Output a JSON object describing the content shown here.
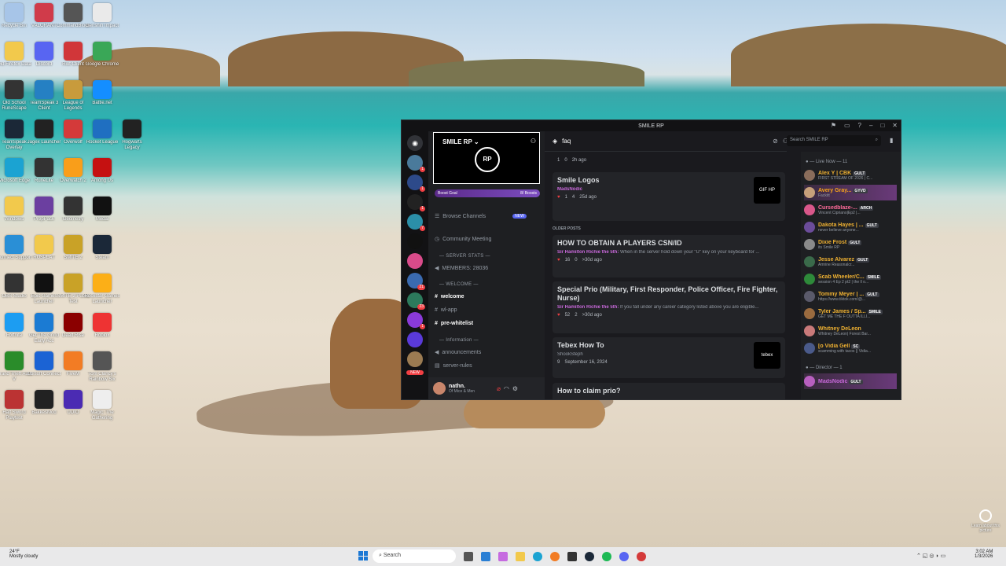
{
  "desktop_icons": [
    {
      "label": "Recycle Bin",
      "color": "#a7c5e8"
    },
    {
      "label": "VALORANT",
      "color": "#d03b4a"
    },
    {
      "label": "CommandBlock",
      "color": "#555"
    },
    {
      "label": "Genshin Impact",
      "color": "#eaeaea"
    },
    {
      "label": "Old Firefox Data",
      "color": "#f2c94c"
    },
    {
      "label": "Discord",
      "color": "#5865f2"
    },
    {
      "label": "Riot Client",
      "color": "#d13639"
    },
    {
      "label": "Google Chrome",
      "color": "#3aa757"
    },
    {
      "label": "Old School RuneScape",
      "color": "#333"
    },
    {
      "label": "TeamSpeak 3 Client",
      "color": "#2580c3"
    },
    {
      "label": "League of Legends",
      "color": "#c89b3c"
    },
    {
      "label": "Battle.net",
      "color": "#148eff"
    },
    {
      "label": "TeamSpeak Overlay",
      "color": "#1b2837"
    },
    {
      "label": "Jagex Launcher",
      "color": "#222"
    },
    {
      "label": "Overwolf",
      "color": "#d43a3a"
    },
    {
      "label": "Rocket League",
      "color": "#1f6fc1"
    },
    {
      "label": "Hogwarts Legacy",
      "color": "#222"
    },
    {
      "label": "Microsoft Edge",
      "color": "#1ba3d2"
    },
    {
      "label": "RuneLite",
      "color": "#333"
    },
    {
      "label": "Overwatch 2",
      "color": "#f99e1a"
    },
    {
      "label": "Among Us",
      "color": "#c51111"
    },
    {
      "label": "Windows",
      "color": "#f2c94c"
    },
    {
      "label": "PrepPack",
      "color": "#6b3fa0"
    },
    {
      "label": "Geometry",
      "color": "#333"
    },
    {
      "label": "Medal",
      "color": "#111"
    },
    {
      "label": "Connect Support",
      "color": "#2a8fd6"
    },
    {
      "label": "RUSPLAT",
      "color": "#f2c94c"
    },
    {
      "label": "SMITE 2",
      "color": "#c9a227"
    },
    {
      "label": "Steam",
      "color": "#1b2838"
    },
    {
      "label": "OBS Studio",
      "color": "#333"
    },
    {
      "label": "Epic Games Launcher",
      "color": "#111"
    },
    {
      "label": "SMITE 2 Public Test",
      "color": "#c9a227"
    },
    {
      "label": "Rockstar Games Launcher",
      "color": "#fcaf17"
    },
    {
      "label": "Fortnite",
      "color": "#1c9df2"
    },
    {
      "label": "Get The Grind Early Acc",
      "color": "#1b7bd3"
    },
    {
      "label": "Dead Rise",
      "color": "#8b0000"
    },
    {
      "label": "Roblox",
      "color": "#e33"
    },
    {
      "label": "Grand Theft Auto V",
      "color": "#2a8c2a"
    },
    {
      "label": "Ubisoft Connect",
      "color": "#1b63d4"
    },
    {
      "label": "FiveM",
      "color": "#f27c24"
    },
    {
      "label": "Tom Clancy's Rainbow Six",
      "color": "#555"
    },
    {
      "label": "Half Sword Playtest",
      "color": "#b33"
    },
    {
      "label": "BakkesMod",
      "color": "#222"
    },
    {
      "label": "UDIO",
      "color": "#4b2bb3"
    },
    {
      "label": "Magic: The Gathering",
      "color": "#eee"
    }
  ],
  "discord": {
    "window_title": "SMILE RP",
    "server_name": "SMILE RP",
    "banner_logo": "RP",
    "boost_goal_label": "Boost Goal",
    "boost_count": "8/ Boosts",
    "browse_channels": "Browse Channels",
    "new_tag": "NEW",
    "community_meeting": "Community Meeting",
    "server_stats_header": "SERVER STATS",
    "members_stat": "MEMBERS: 28036",
    "welcome_header": "WELCOME",
    "channels": [
      {
        "name": "welcome",
        "active": true
      },
      {
        "name": "wl-app",
        "active": false
      },
      {
        "name": "pre-whitelist",
        "active": true
      }
    ],
    "information_header": "Information",
    "info_channels": [
      "announcements",
      "server-rules"
    ],
    "user_name": "nathn.",
    "user_status": "Of Mice & Men",
    "forum_channel": "faq",
    "search_placeholder": "Search SMILE RP",
    "first_post_meta": {
      "reactions": "1",
      "comments": "0",
      "time": "2h ago"
    },
    "posts": [
      {
        "title": "Smile Logos",
        "author": "MadsNodic",
        "excerpt": "",
        "reactions": "1",
        "comments": "4",
        "time": "25d ago",
        "thumb": "GIF HP"
      },
      {
        "title": "HOW TO OBTAIN A PLAYERS CSN/ID",
        "author": "Sir Hamilton Richie the 5th:",
        "excerpt": "When in the server hold down your \"U\" key on your keyboard for ...",
        "reactions": "16",
        "comments": "0",
        "time": ">30d ago",
        "thumb": ""
      },
      {
        "title": "Special Prio (Military, First Responder, Police Officer, Fire Fighter, Nurse)",
        "author": "Sir Hamilton Richie the 5th:",
        "excerpt": "If you fall under any career category listed above you are eligible...",
        "reactions": "52",
        "comments": "2",
        "time": ">30d ago",
        "thumb": ""
      },
      {
        "title": "Tebex How To",
        "author": "ShookSteph",
        "excerpt": "",
        "reactions": "",
        "comments": "9",
        "time": "September 16, 2024",
        "thumb": "tebex"
      },
      {
        "title": "How to claim prio?",
        "author": "",
        "excerpt": "",
        "reactions": "",
        "comments": "",
        "time": "",
        "thumb": ""
      }
    ],
    "older_posts_label": "OLDER POSTS",
    "live_now": "Live Now — 11",
    "director": "Director — 1",
    "members": [
      {
        "name": "Alex Y | CBK",
        "tag": "GULT",
        "status": "FIRST STREAM OF 2026 | C...",
        "color": "#f0b232"
      },
      {
        "name": "Avery Gray...",
        "tag": "GYVD",
        "status": "Fackitt",
        "color": "#faa61a"
      },
      {
        "name": "Cursedblaze-...",
        "tag": "ARCH",
        "status": "Vincent Cipriano|Ep2 |...",
        "color": "#ff6b9a"
      },
      {
        "name": "Dakota Hayes | ...",
        "tag": "GULT",
        "status": "never believe anyone...",
        "color": "#f0b232"
      },
      {
        "name": "Dixie Frost",
        "tag": "GULT",
        "status": "its Smile RP",
        "color": "#f0b232"
      },
      {
        "name": "Jesse Alvarez",
        "tag": "GULT",
        "status": "Amrine Reasonalcr...",
        "color": "#f0b232"
      },
      {
        "name": "Scab Wheeler/C...",
        "tag": "SMILE",
        "status": "session 4 Ep 2 pt2 | the ll o...",
        "color": "#f0b232"
      },
      {
        "name": "Tommy Meyer | ...",
        "tag": "GULT",
        "status": "https://www.tiktok.com/@...",
        "color": "#f0b232"
      },
      {
        "name": "Tyler James / Sp...",
        "tag": "SMILE",
        "status": "GET ME THE F OUTTA ILLI...",
        "color": "#f0b232"
      },
      {
        "name": "Whitney DeLeon",
        "tag": "",
        "status": "Whitney DeLeon| Forest Bar...",
        "color": "#f0b232"
      },
      {
        "name": "[o Vidia Gell",
        "tag": "SC",
        "status": "scamming with tacos || Vidia...",
        "color": "#f0b232"
      },
      {
        "name": "MadsNodic",
        "tag": "GULT",
        "status": "",
        "color": "#c768d9"
      }
    ]
  },
  "taskbar": {
    "weather_temp": "24°F",
    "weather_desc": "Mostly cloudy",
    "search_label": "Search",
    "time": "3:02 AM",
    "date": "1/3/2026"
  },
  "recycle_corner": "Learn about this picture"
}
